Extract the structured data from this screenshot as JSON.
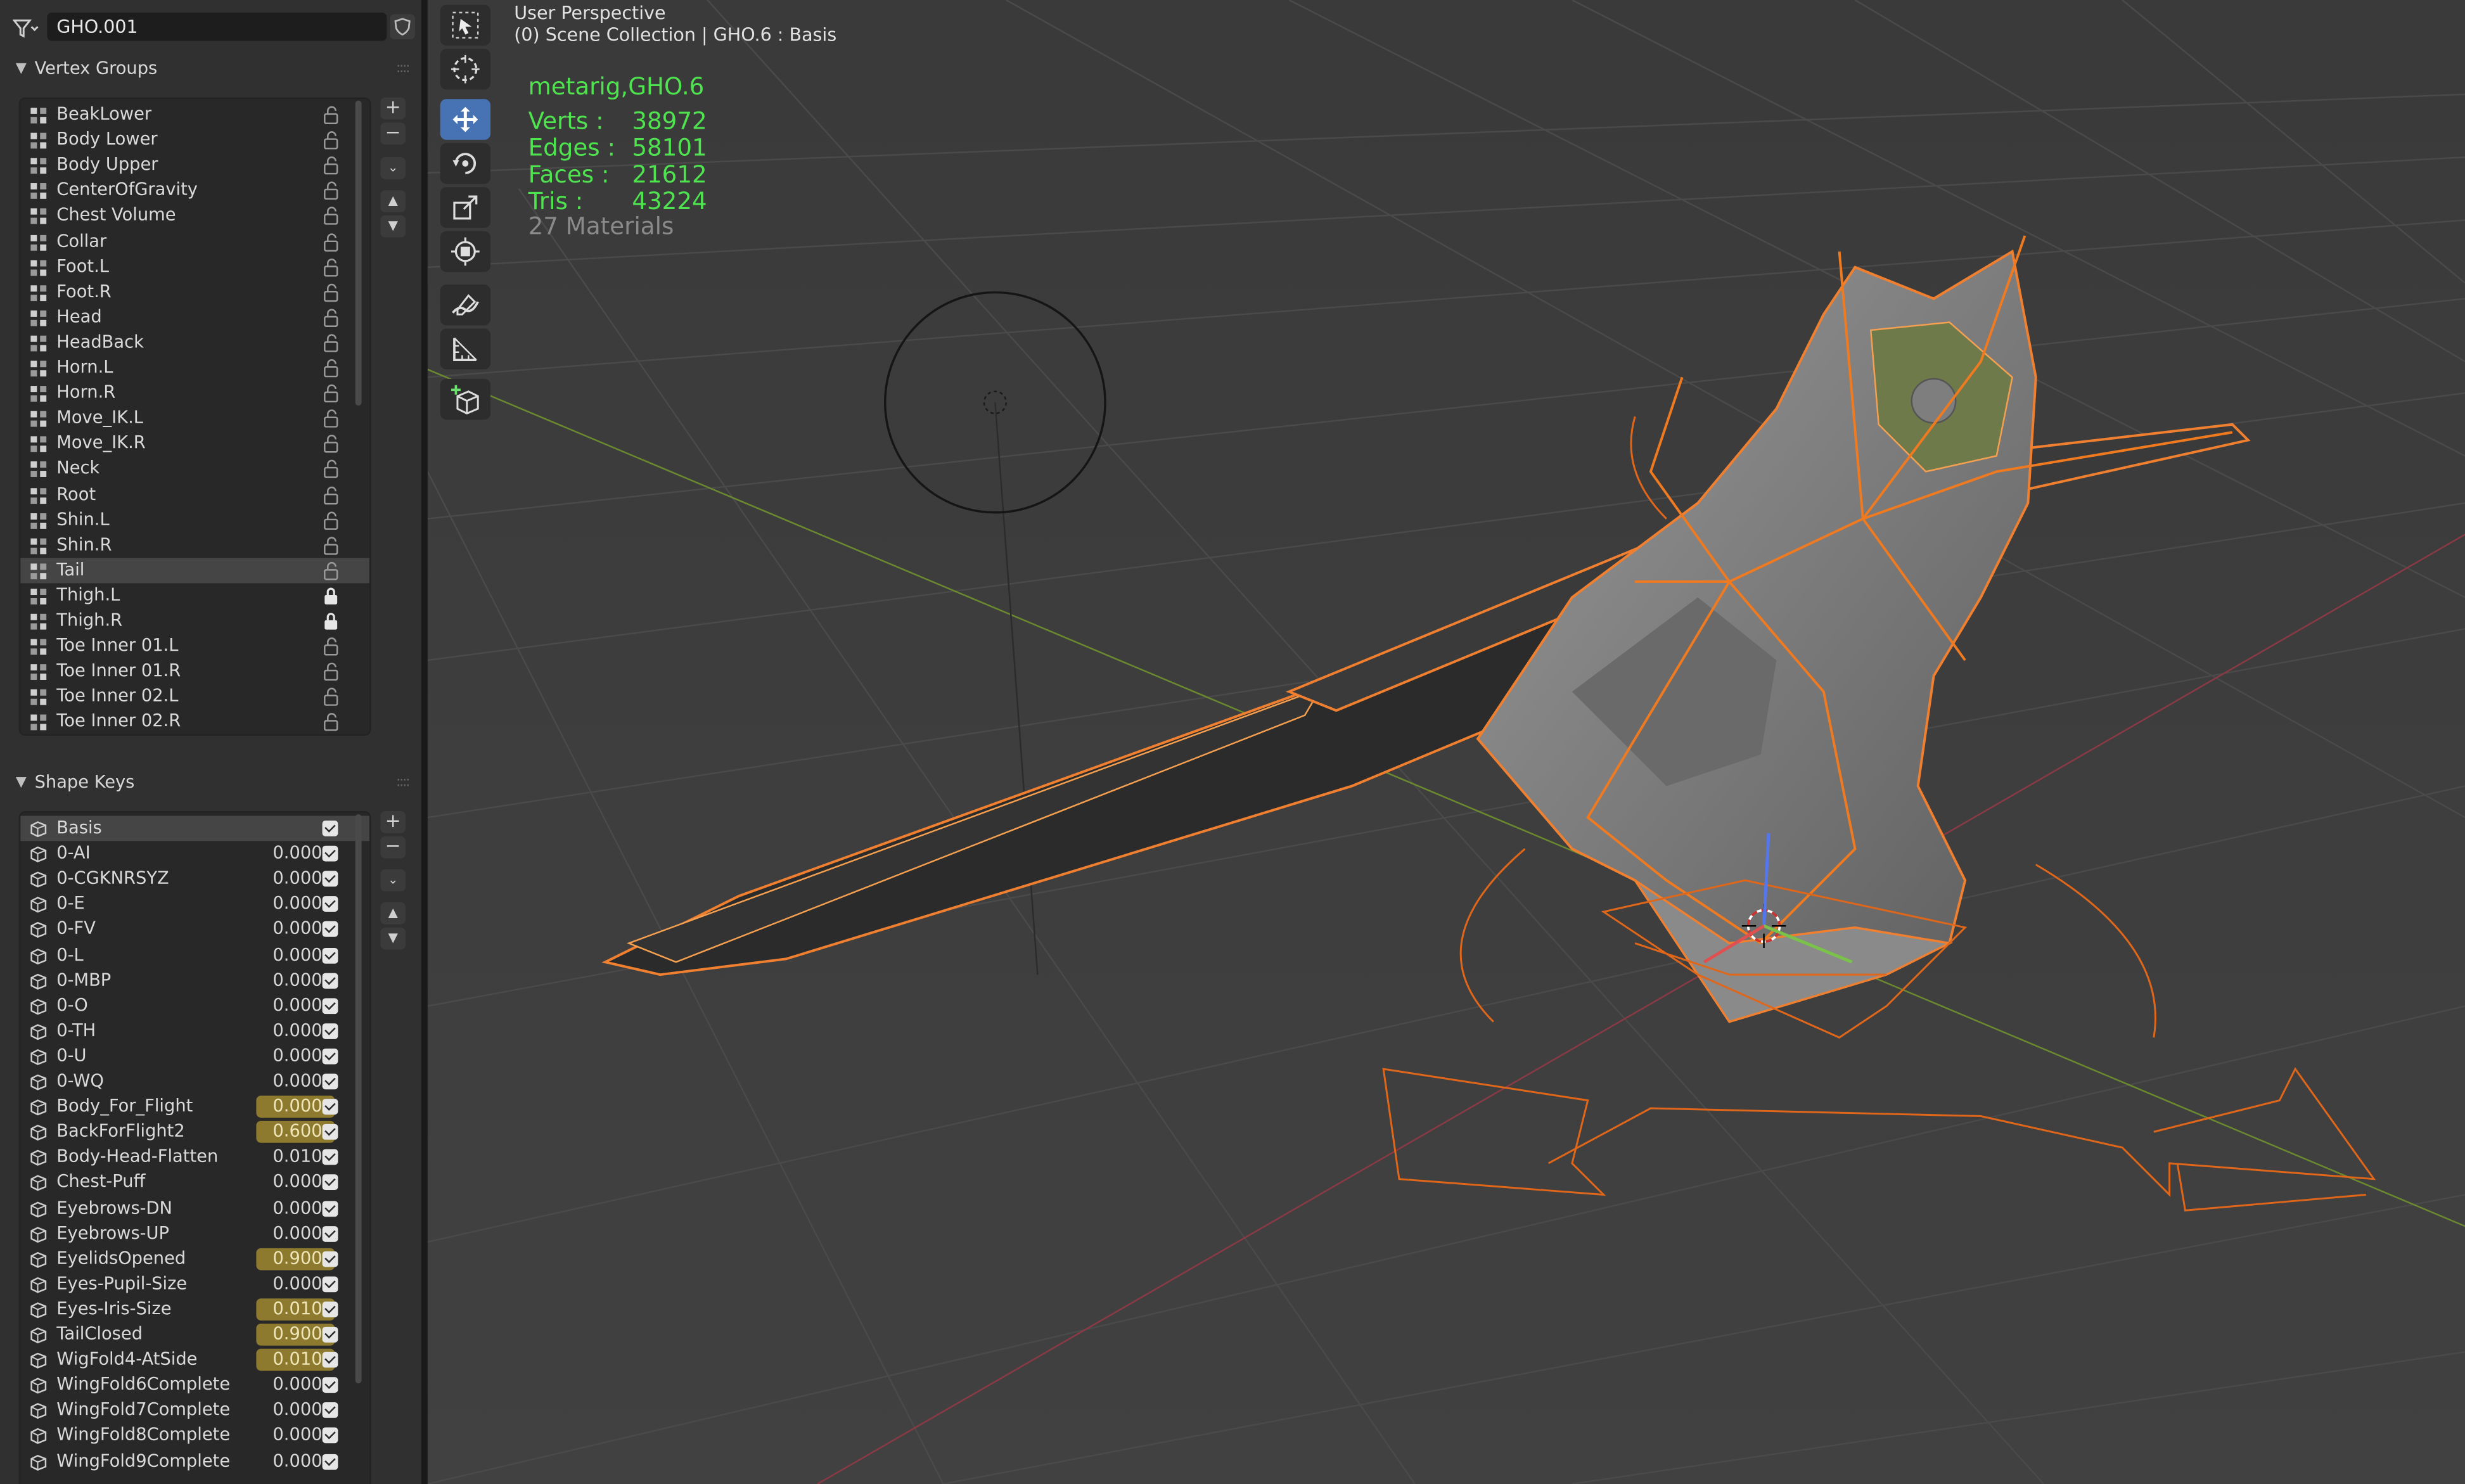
{
  "header": {
    "object_name": "GHO.001"
  },
  "vertex_groups": {
    "title": "Vertex Groups",
    "items": [
      {
        "name": "BeakLower",
        "locked": false
      },
      {
        "name": "Body Lower",
        "locked": false
      },
      {
        "name": "Body Upper",
        "locked": false
      },
      {
        "name": "CenterOfGravity",
        "locked": false
      },
      {
        "name": "Chest Volume",
        "locked": false
      },
      {
        "name": "Collar",
        "locked": false
      },
      {
        "name": "Foot.L",
        "locked": false
      },
      {
        "name": "Foot.R",
        "locked": false
      },
      {
        "name": "Head",
        "locked": false
      },
      {
        "name": "HeadBack",
        "locked": false
      },
      {
        "name": "Horn.L",
        "locked": false
      },
      {
        "name": "Horn.R",
        "locked": false
      },
      {
        "name": "Move_IK.L",
        "locked": false
      },
      {
        "name": "Move_IK.R",
        "locked": false
      },
      {
        "name": "Neck",
        "locked": false
      },
      {
        "name": "Root",
        "locked": false
      },
      {
        "name": "Shin.L",
        "locked": false
      },
      {
        "name": "Shin.R",
        "locked": false
      },
      {
        "name": "Tail",
        "locked": false,
        "selected": true
      },
      {
        "name": "Thigh.L",
        "locked": true
      },
      {
        "name": "Thigh.R",
        "locked": true
      },
      {
        "name": "Toe Inner 01.L",
        "locked": false
      },
      {
        "name": "Toe Inner 01.R",
        "locked": false
      },
      {
        "name": "Toe Inner 02.L",
        "locked": false
      },
      {
        "name": "Toe Inner 02.R",
        "locked": false
      }
    ],
    "add_label": "+",
    "remove_label": "−"
  },
  "shape_keys": {
    "title": "Shape Keys",
    "items": [
      {
        "name": "Basis",
        "value": "",
        "selected": true,
        "enabled": true
      },
      {
        "name": "0-AI",
        "value": "0.000",
        "enabled": true
      },
      {
        "name": "0-CGKNRSYZ",
        "value": "0.000",
        "enabled": true
      },
      {
        "name": "0-E",
        "value": "0.000",
        "enabled": true
      },
      {
        "name": "0-FV",
        "value": "0.000",
        "enabled": true
      },
      {
        "name": "0-L",
        "value": "0.000",
        "enabled": true
      },
      {
        "name": "0-MBP",
        "value": "0.000",
        "enabled": true
      },
      {
        "name": "0-O",
        "value": "0.000",
        "enabled": true
      },
      {
        "name": "0-TH",
        "value": "0.000",
        "enabled": true
      },
      {
        "name": "0-U",
        "value": "0.000",
        "enabled": true
      },
      {
        "name": "0-WQ",
        "value": "0.000",
        "enabled": true
      },
      {
        "name": "Body_For_Flight",
        "value": "0.000",
        "highlight": true,
        "enabled": true
      },
      {
        "name": "BackForFlight2",
        "value": "0.600",
        "highlight": true,
        "enabled": true
      },
      {
        "name": "Body-Head-Flatten",
        "value": "0.010",
        "enabled": true
      },
      {
        "name": "Chest-Puff",
        "value": "0.000",
        "enabled": true
      },
      {
        "name": "Eyebrows-DN",
        "value": "0.000",
        "enabled": true
      },
      {
        "name": "Eyebrows-UP",
        "value": "0.000",
        "enabled": true
      },
      {
        "name": "EyelidsOpened",
        "value": "0.900",
        "highlight": true,
        "enabled": true
      },
      {
        "name": "Eyes-Pupil-Size",
        "value": "0.000",
        "enabled": true
      },
      {
        "name": "Eyes-Iris-Size",
        "value": "0.010",
        "highlight": true,
        "enabled": true
      },
      {
        "name": "TailClosed",
        "value": "0.900",
        "highlight": true,
        "enabled": true
      },
      {
        "name": "WigFold4-AtSide",
        "value": "0.010",
        "highlight": true,
        "enabled": true
      },
      {
        "name": "WingFold6Complete",
        "value": "0.000",
        "enabled": true
      },
      {
        "name": "WingFold7Complete",
        "value": "0.000",
        "enabled": true
      },
      {
        "name": "WingFold8Complete",
        "value": "0.000",
        "enabled": true
      },
      {
        "name": "WingFold9Complete",
        "value": "0.000",
        "enabled": true
      }
    ],
    "add_label": "+",
    "remove_label": "−"
  },
  "viewport": {
    "view_name": "User Perspective",
    "collection_line": "(0) Scene Collection | GHO.6 : Basis",
    "stats": {
      "object": "metarig,GHO.6",
      "rows": [
        {
          "label": "Verts :",
          "value": "38972"
        },
        {
          "label": "Edges :",
          "value": "58101"
        },
        {
          "label": "Faces :",
          "value": "21612"
        },
        {
          "label": "Tris :",
          "value": "43224"
        }
      ],
      "materials": "27 Materials"
    },
    "tools": [
      "select-box-icon",
      "cursor-icon",
      "move-icon",
      "rotate-icon",
      "scale-icon",
      "transform-icon",
      "annotate-icon",
      "measure-icon",
      "add-cube-icon"
    ],
    "active_tool": "move-icon"
  },
  "colors": {
    "accent": "#4772b3",
    "selection_orange": "#f08030",
    "stat_green": "#4fe34f",
    "shape_key_highlight": "#8d7a2f"
  }
}
